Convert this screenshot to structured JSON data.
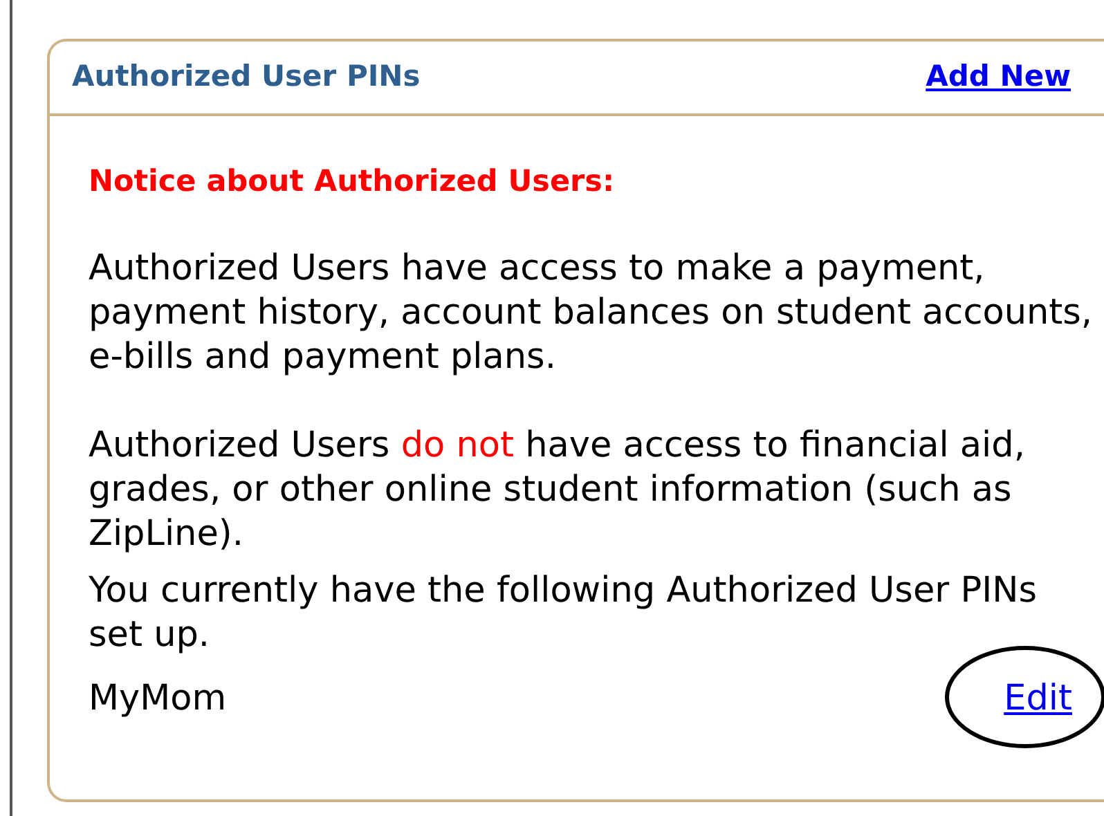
{
  "panel": {
    "title": "Authorized User PINs",
    "action_link": "Add New"
  },
  "notice": {
    "heading": "Notice about Authorized Users:"
  },
  "paragraphs": [
    {
      "parts": [
        {
          "text": "Authorized Users have access to make a payment, payment history, account balances on student accounts, e-bills and payment plans.",
          "emphasis": false
        }
      ]
    },
    {
      "parts": [
        {
          "text": "Authorized Users ",
          "emphasis": false
        },
        {
          "text": "do not",
          "emphasis": true
        },
        {
          "text": " have access to financial aid, grades, or other online student information (such as ZipLine).",
          "emphasis": false
        }
      ]
    }
  ],
  "pins_intro": "You currently have the following Authorized User PINs set up.",
  "pins": [
    {
      "name": "MyMom",
      "action": "Edit",
      "circled": true
    }
  ]
}
